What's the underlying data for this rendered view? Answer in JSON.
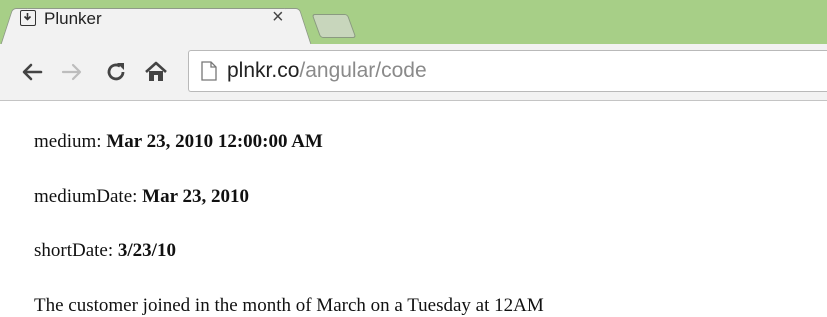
{
  "browser": {
    "tab": {
      "title": "Plunker",
      "close_glyph": "×",
      "favicon_icon": "download-box-icon"
    },
    "new_tab_icon": "new-tab-icon",
    "nav": {
      "back_icon": "back-arrow-icon",
      "forward_icon": "forward-arrow-icon",
      "reload_icon": "reload-icon",
      "home_icon": "home-icon"
    },
    "address_bar": {
      "page_icon": "page-icon",
      "host": "plnkr.co",
      "path": "/angular/code"
    },
    "colors": {
      "tabstrip": "#a7cf87",
      "toolbar": "#f2f2f2"
    }
  },
  "page": {
    "medium": {
      "label": "medium: ",
      "value": "Mar 23, 2010 12:00:00 AM"
    },
    "mediumDate": {
      "label": "mediumDate: ",
      "value": "Mar 23, 2010"
    },
    "shortDate": {
      "label": "shortDate: ",
      "value": "3/23/10"
    },
    "sentence": "The customer joined in the month of March on a Tuesday at 12AM"
  }
}
